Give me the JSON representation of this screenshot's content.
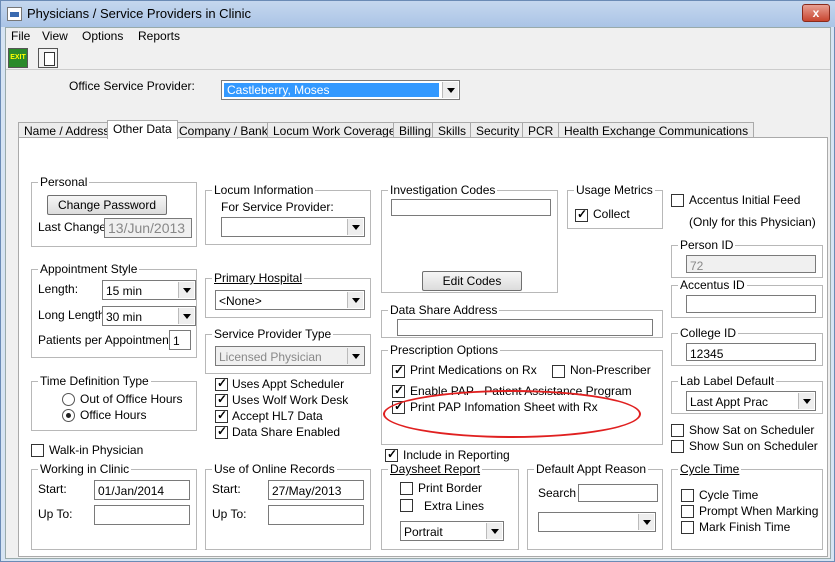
{
  "window": {
    "title": "Physicians / Service Providers in Clinic",
    "close_label": "x"
  },
  "menu": [
    "File",
    "View",
    "Options",
    "Reports"
  ],
  "toolbar": {
    "exit_label": "EXIT"
  },
  "provider": {
    "label": "Office Service Provider:",
    "value": "Castleberry, Moses"
  },
  "tabs": [
    "Name / Address",
    "Other Data",
    "Company / Bank",
    "Locum Work Coverage",
    "Billing",
    "Skills",
    "Security",
    "PCR",
    "Health Exchange Communications"
  ],
  "personal": {
    "title": "Personal",
    "change_password": "Change Password",
    "last_change_label": "Last Change",
    "last_change_value": "13/Jun/2013"
  },
  "appt_style": {
    "title": "Appointment Style",
    "length_label": "Length:",
    "length_value": "15 min",
    "long_length_label": "Long Length:",
    "long_length_value": "30 min",
    "patients_label": "Patients per Appointment:",
    "patients_value": "1"
  },
  "time_def": {
    "title": "Time Definition Type",
    "opt1": "Out of Office Hours",
    "opt2": "Office Hours"
  },
  "walkin": {
    "label": "Walk-in Physician"
  },
  "working": {
    "title": "Working in Clinic",
    "start_label": "Start:",
    "start_value": "01/Jan/2014",
    "upto_label": "Up To:",
    "upto_value": ""
  },
  "locum": {
    "title": "Locum Information",
    "for_label": "For Service Provider:",
    "value": ""
  },
  "hospital": {
    "title": "Primary Hospital",
    "value": "<None>"
  },
  "sp_type": {
    "title": "Service Provider Type",
    "value": "Licensed Physician"
  },
  "checks": {
    "appt_sched": "Uses Appt Scheduler",
    "wolf": "Uses Wolf Work Desk",
    "hl7": "Accept HL7 Data",
    "data_share": "Data Share Enabled"
  },
  "online": {
    "title": "Use of Online Records",
    "start_label": "Start:",
    "start_value": "27/May/2013",
    "upto_label": "Up To:",
    "upto_value": ""
  },
  "investigation": {
    "title": "Investigation Codes",
    "value": "",
    "edit_codes": "Edit Codes"
  },
  "usage": {
    "title": "Usage Metrics",
    "collect": "Collect"
  },
  "data_share_addr": {
    "title": "Data Share Address",
    "value": ""
  },
  "rx": {
    "title": "Prescription Options",
    "print_meds": "Print Medications on Rx",
    "non_prescriber": "Non-Prescriber",
    "enable_pap": "Enable PAP - Patient Assistance Program",
    "print_pap": "Print PAP Infomation Sheet with Rx"
  },
  "include_reporting": "Include in Reporting",
  "daysheet": {
    "title": "Daysheet Report",
    "print_border": "Print Border",
    "extra_lines": "Extra Lines",
    "orientation": "Portrait"
  },
  "default_appt": {
    "title": "Default Appt Reason",
    "search_label": "Search",
    "search_value": "",
    "value": ""
  },
  "accentus": {
    "initial_feed": "Accentus Initial Feed",
    "note": "(Only for this Physician)"
  },
  "person_id": {
    "title": "Person ID",
    "value": "72"
  },
  "accentus_id": {
    "title": "Accentus ID",
    "value": ""
  },
  "college_id": {
    "title": "College ID",
    "value": "12345"
  },
  "lab_label": {
    "title": "Lab Label Default",
    "value": "Last Appt Prac"
  },
  "show_sat": "Show Sat on Scheduler",
  "show_sun": "Show Sun on Scheduler",
  "cycle": {
    "title": "Cycle Time",
    "cycle_time": "Cycle Time",
    "prompt": "Prompt When Marking",
    "mark_finish": "Mark Finish Time"
  }
}
